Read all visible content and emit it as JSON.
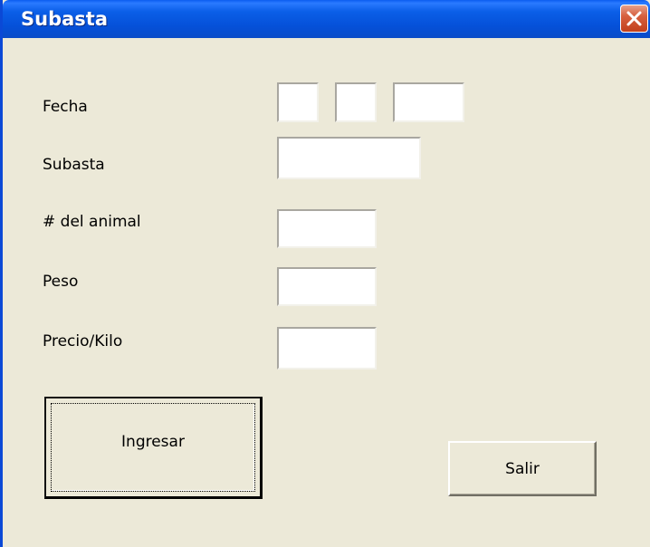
{
  "window": {
    "title": "Subasta",
    "close_icon": "close-icon"
  },
  "form": {
    "fecha_label": "Fecha",
    "fecha_day": "",
    "fecha_month": "",
    "fecha_year": "",
    "subasta_label": "Subasta",
    "subasta_value": "",
    "animal_label": "# del animal",
    "animal_value": "",
    "peso_label": "Peso",
    "peso_value": "",
    "precio_label": "Precio/Kilo",
    "precio_value": ""
  },
  "buttons": {
    "ingresar_label": "Ingresar",
    "salir_label": "Salir"
  },
  "colors": {
    "titlebar": "#0550d8",
    "window_bg": "#ece9d8",
    "close_button": "#c2401c"
  }
}
